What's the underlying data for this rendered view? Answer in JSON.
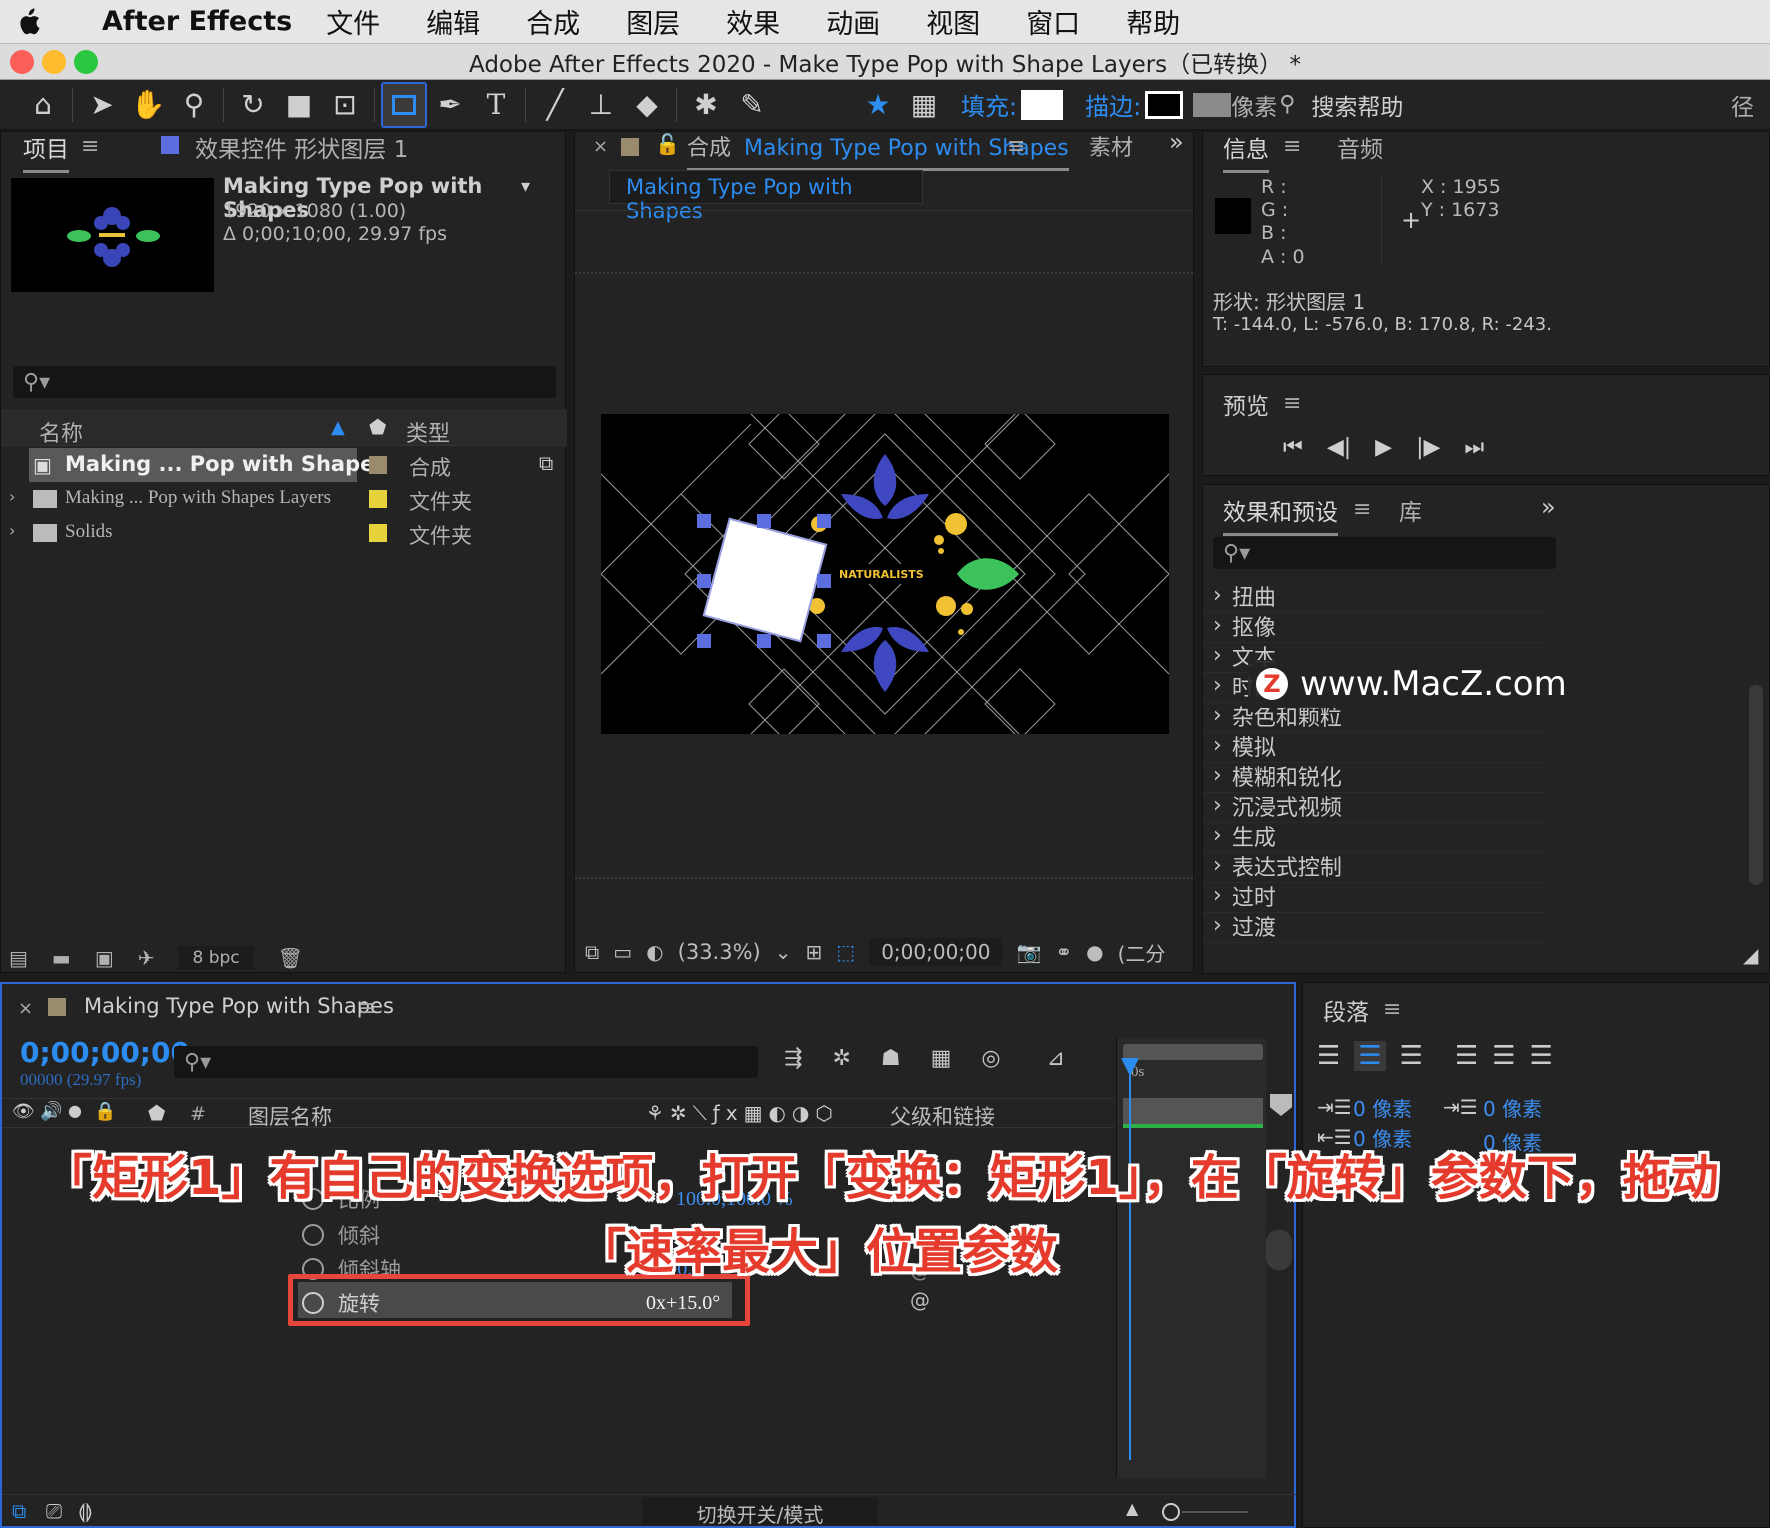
{
  "menubar": {
    "app_name": "After Effects",
    "items": [
      "文件",
      "编辑",
      "合成",
      "图层",
      "效果",
      "动画",
      "视图",
      "窗口",
      "帮助"
    ]
  },
  "window": {
    "title": "Adobe After Effects 2020 - Make Type Pop with Shape Layers（已转换） *"
  },
  "toolbar": {
    "fill_label": "填充:",
    "stroke_label": "描边:",
    "stroke_px": "像素",
    "search_help": "搜索帮助",
    "right_glyph": "径"
  },
  "project_panel": {
    "tab_project": "项目",
    "tab_effects": "效果控件 形状图层 1",
    "comp_name": "Making Type Pop with Shapes",
    "comp_dims": "1920 x 1080 (1.00)",
    "comp_duration": "Δ 0;00;10;00, 29.97 fps",
    "col_name": "名称",
    "col_type": "类型",
    "items": [
      {
        "name": "Making ... Pop with Shapes",
        "type": "合成",
        "color": "#9b8b6e"
      },
      {
        "name": "Making ... Pop with Shapes Layers",
        "type": "文件夹",
        "color": "#e6d23a"
      },
      {
        "name": "Solids",
        "type": "文件夹",
        "color": "#e6d23a"
      }
    ],
    "bpc": "8 bpc"
  },
  "comp_panel": {
    "tab_label": "合成",
    "tab_name": "Making Type Pop with Shapes",
    "tab_more": "素材",
    "breadcrumb": "Making Type Pop with Shapes",
    "logo_text": "NATURALISTS",
    "zoom": "(33.3%)",
    "timecode": "0;00;00;00",
    "resolution": "(二分"
  },
  "info_panel": {
    "tab_info": "信息",
    "tab_audio": "音频",
    "r": "R :",
    "g": "G :",
    "b": "B :",
    "a": "A :  0",
    "x": "X : 1955",
    "y": "Y :  1673",
    "shape": "形状: 形状图层 1",
    "bounds": "T: -144.0,   L: -576.0,   B: 170.8,   R: -243."
  },
  "preview_panel": {
    "title": "预览"
  },
  "effects_panel": {
    "tab_effects": "效果和预设",
    "tab_library": "库",
    "items": [
      "扭曲",
      "抠像",
      "文本",
      "时间",
      "杂色和颗粒",
      "模拟",
      "模糊和锐化",
      "沉浸式视频",
      "生成",
      "表达式控制",
      "过时",
      "过渡"
    ]
  },
  "watermark": "www.MacZ.com",
  "timeline": {
    "comp_name": "Making Type Pop with Shapes",
    "timecode": "0;00;00;00",
    "frames": "00000 (29.97 fps)",
    "col_layer_name": "图层名称",
    "col_hash": "#",
    "col_parent": "父级和链接",
    "ruler_label": "0s",
    "properties": [
      {
        "name": "比例",
        "value": "100.0,100.0 %"
      },
      {
        "name": "倾斜",
        "value": ""
      },
      {
        "name": "倾斜轴",
        "value": "0x+0.0"
      },
      {
        "name": "旋转",
        "value": "0x+15.0°"
      }
    ],
    "footer_toggle": "切换开关/模式"
  },
  "paragraph_panel": {
    "title": "段落",
    "indent1": "0 像素",
    "indent2": "0 像素",
    "indent3": "0 像素",
    "indent4": "0 像素"
  },
  "overlay": {
    "line1": "「矩形1」有自己的变换选项，打开「变换：矩形1」，在「旋转」参数下，拖动",
    "line2": "「速率最大」位置参数"
  },
  "colors": {
    "accent_blue": "#2d8cf0",
    "highlight_red": "#e8463a",
    "panel_bg": "#232323"
  }
}
